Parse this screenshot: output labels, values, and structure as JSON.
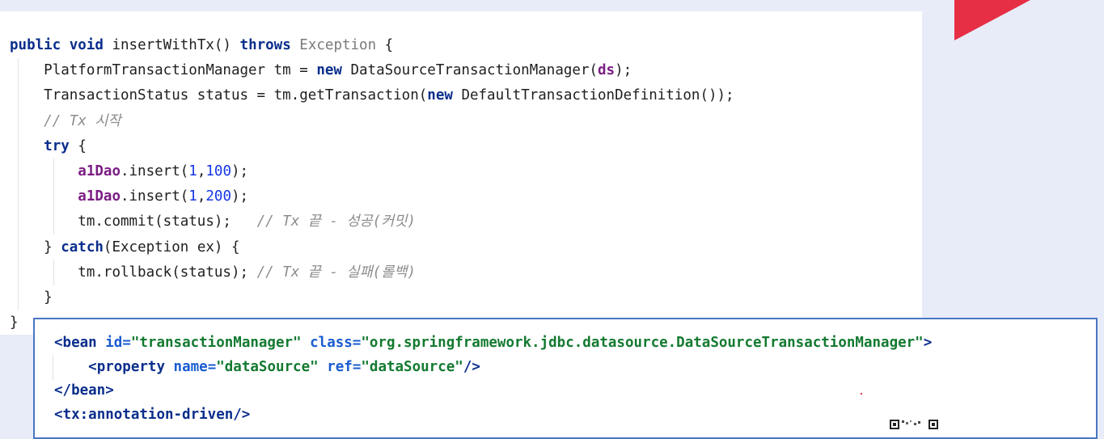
{
  "java": {
    "l1": {
      "kw_public": "public",
      "kw_void": "void",
      "method_sig": "insertWithTx()",
      "kw_throws": "throws",
      "exception_type": "Exception",
      "brace": "{"
    },
    "l2": {
      "decl": "PlatformTransactionManager tm = ",
      "kw_new": "new",
      "ctor": "DataSourceTransactionManager(",
      "arg": "ds",
      "end": ");"
    },
    "l3": {
      "decl": "TransactionStatus status = tm.getTransaction(",
      "kw_new": "new",
      "rest": "DefaultTransactionDefinition());"
    },
    "l4": {
      "comment": "// Tx 시작"
    },
    "l5": {
      "kw_try": "try",
      "brace": "{"
    },
    "l6": {
      "field": "a1Dao",
      "call": ".insert(",
      "n1": "1",
      "comma": ",",
      "n2": "100",
      "end": ");"
    },
    "l7": {
      "field": "a1Dao",
      "call": ".insert(",
      "n1": "1",
      "comma": ",",
      "n2": "200",
      "end": ");"
    },
    "l8": {
      "code": "tm.commit(status);   ",
      "comment": "// Tx 끝 - 성공(커밋)"
    },
    "l9": {
      "brace_open": "} ",
      "kw_catch": "catch",
      "rest": "(Exception ex) {"
    },
    "l10": {
      "code": "tm.rollback(status); ",
      "comment": "// Tx 끝 - 실패(롤백)"
    },
    "l11": {
      "brace": "}"
    },
    "l12": {
      "brace": "}"
    }
  },
  "xml": {
    "l1": {
      "open": "<",
      "tag": "bean",
      "id_attr": "id=",
      "id_val": "\"transactionManager\"",
      "class_attr": "class=",
      "class_val": "\"org.springframework.jdbc.datasource.DataSourceTransactionManager\"",
      "close": ">"
    },
    "l2": {
      "open": "<",
      "tag": "property",
      "name_attr": "name=",
      "name_val": "\"dataSource\"",
      "ref_attr": "ref=",
      "ref_val": "\"dataSource\"",
      "close": "/>"
    },
    "l3": {
      "open": "</",
      "tag": "bean",
      "close": ">"
    },
    "l4": {
      "open": "<",
      "tag": "tx:annotation-driven",
      "close": "/>"
    }
  },
  "colors": {
    "keyword": "#0a2e8c",
    "field": "#7b1d84",
    "number": "#1336e6",
    "comment": "#8c8c8c",
    "xml_attribute": "#1a5cd0",
    "xml_string": "#137a30",
    "accent_red": "#e62e45",
    "box_border": "#4a76c3"
  },
  "icons": {
    "corner": "red-triangle-logo",
    "qr": "qr-code-icon"
  }
}
